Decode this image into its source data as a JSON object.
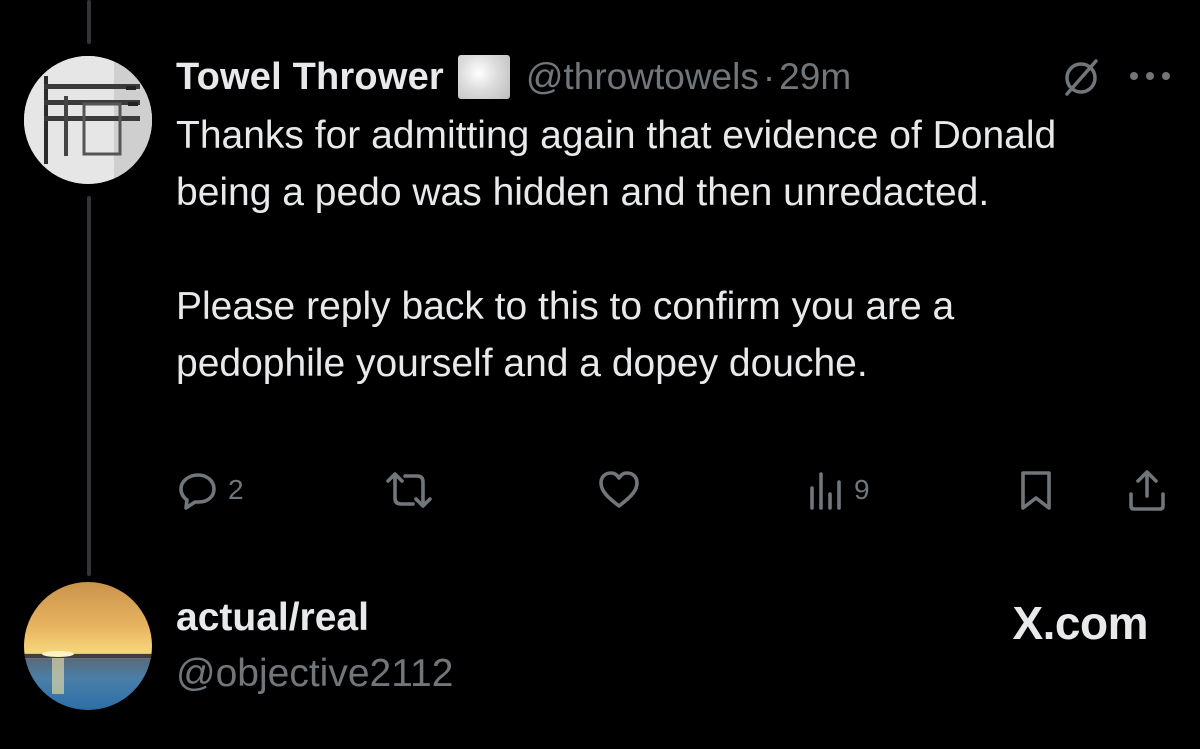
{
  "tweet": {
    "display_name": "Towel Thrower",
    "handle": "@throwtowels",
    "separator": "·",
    "time": "29m",
    "body_line1": "Thanks for admitting again that evidence of Donald being a pedo was hidden and then unredacted.",
    "body_line2": "Please reply back to this to confirm you are a pedophile yourself and a dopey douche.",
    "actions": {
      "reply_count": "2",
      "repost_count": "",
      "like_count": "",
      "views_count": "9"
    },
    "icons": {
      "reply": "reply-icon",
      "repost": "repost-icon",
      "like": "heart-icon",
      "views": "views-icon",
      "bookmark": "bookmark-icon",
      "share": "share-icon",
      "grok": "grok-icon",
      "more": "more-icon"
    }
  },
  "quote_author": {
    "display_name": "actual/real",
    "handle": "@objective2112"
  },
  "watermark": "X.com",
  "colors": {
    "background": "#000000",
    "text_primary": "#e7e9ea",
    "text_secondary": "#71767b",
    "thread_line": "#333639"
  }
}
